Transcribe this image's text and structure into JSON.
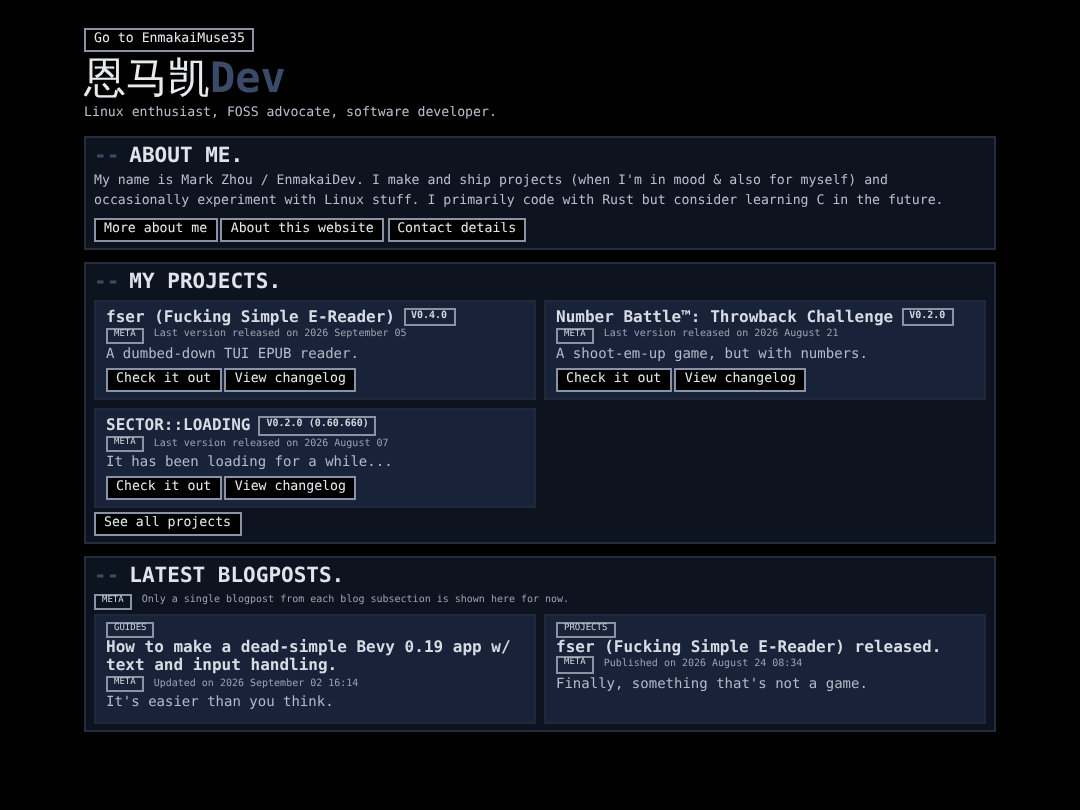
{
  "top_link": "Go to EnmakaiMuse35",
  "site_title": {
    "main": "恩马凯",
    "accent": "Dev"
  },
  "tagline": "Linux enthusiast, FOSS advocate, software developer.",
  "sections": [
    {
      "kind": "about",
      "prefix": "--",
      "heading": "ABOUT ME.",
      "text": "My name is Mark Zhou / EnmakaiDev. I make and ship projects (when I'm in mood & also for myself) and occasionally experiment with Linux stuff. I primarily code with Rust but consider learning C in the future.",
      "buttons": [
        "More about me",
        "About this website",
        "Contact details"
      ]
    },
    {
      "kind": "projects",
      "prefix": "--",
      "heading": "MY PROJECTS.",
      "cards": [
        {
          "title": "fser (Fucking Simple E-Reader)",
          "version": "V0.4.0",
          "meta_tag": "META",
          "meta": "Last version released on 2026 September 05",
          "description": "A dumbed-down TUI EPUB reader.",
          "buttons": [
            "Check it out",
            "View changelog"
          ]
        },
        {
          "title": "Number Battle™: Throwback Challenge",
          "version": "V0.2.0",
          "meta_tag": "META",
          "meta": "Last version released on 2026 August 21",
          "description": "A shoot-em-up game, but with numbers.",
          "buttons": [
            "Check it out",
            "View changelog"
          ]
        },
        {
          "title": "SECTOR::LOADING",
          "version": "V0.2.0 (0.60.660)",
          "meta_tag": "META",
          "meta": "Last version released on 2026 August 07",
          "description": "It has been loading for a while...",
          "buttons": [
            "Check it out",
            "View changelog"
          ]
        }
      ],
      "footer_button": "See all projects"
    },
    {
      "kind": "blog",
      "prefix": "--",
      "heading": "LATEST BLOGPOSTS.",
      "note_tag": "META",
      "note": "Only a single blogpost from each blog subsection is shown here for now.",
      "cards": [
        {
          "tag": "GUIDES",
          "title": "How to make a dead-simple Bevy 0.19 app w/ text and input handling.",
          "meta_tag": "META",
          "meta": "Updated on 2026 September 02 16:14",
          "description": "It's easier than you think."
        },
        {
          "tag": "PROJECTS",
          "title": "fser (Fucking Simple E-Reader) released.",
          "meta_tag": "META",
          "meta": "Published on 2026 August 24 08:34",
          "description": "Finally, something that's not a game."
        }
      ]
    }
  ]
}
